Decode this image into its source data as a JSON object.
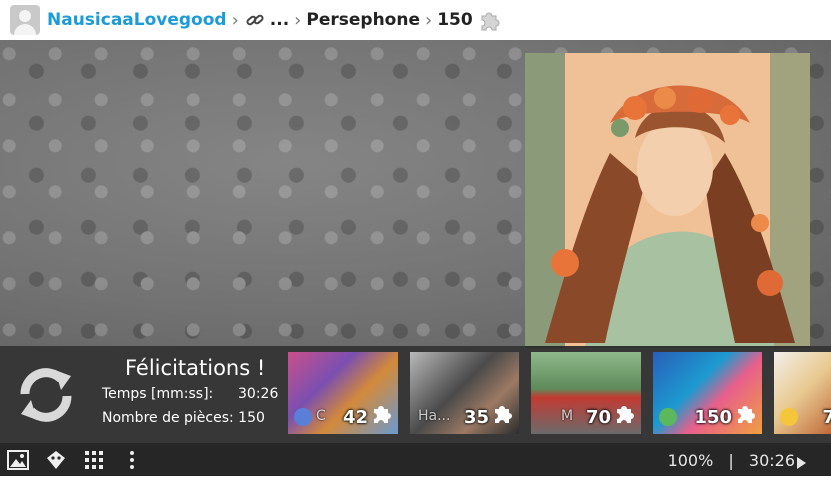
{
  "breadcrumb": {
    "user": "NausicaaLovegood",
    "ellipsis": "...",
    "album": "Persephone",
    "pieces": "150",
    "icons": [
      "user-avatar-icon",
      "link-icon",
      "puzzle-piece-icon"
    ]
  },
  "panel": {
    "title": "Félicitations !",
    "time_label": "Temps [mm:ss]:",
    "time_value": "30:26",
    "pieces_label": "Nombre de pièces: 150",
    "refresh_icon": "refresh-icon"
  },
  "thumbnails": [
    {
      "label": "C",
      "count": "42"
    },
    {
      "label": "Ha...",
      "count": "35"
    },
    {
      "label": "M",
      "count": "70"
    },
    {
      "label": "",
      "count": "150"
    },
    {
      "label": "",
      "count": "7"
    }
  ],
  "toolbar": {
    "icons": [
      "image-icon",
      "ghost-icon",
      "grid-icon",
      "more-vertical-icon"
    ],
    "zoom": "100%",
    "separator": "|",
    "timer": "30:26"
  },
  "colors": {
    "link": "#1b9bd7",
    "panel_bg": "#282828",
    "toolbar_bg": "#262626"
  }
}
